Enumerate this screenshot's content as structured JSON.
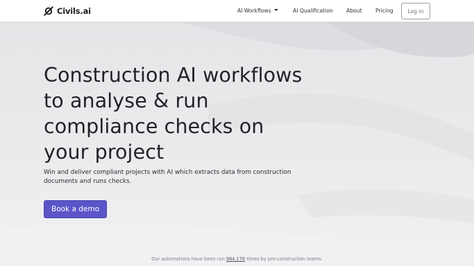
{
  "navbar": {
    "brand": "Civils.ai",
    "items": [
      {
        "label": "AI Workflows",
        "has_dropdown": true
      },
      {
        "label": "AI Qualification"
      },
      {
        "label": "About"
      },
      {
        "label": "Pricing"
      }
    ],
    "login_label": "Log in"
  },
  "hero": {
    "title": "Construction AI workflows to analyse & run compliance checks on your project",
    "subtitle": "Win and deliver compliant projects with AI which extracts data from construction documents and runs checks.",
    "cta_label": "Book a demo"
  },
  "footer_note": {
    "prefix": "Our automations have been run ",
    "count": "984,176",
    "suffix": " times by pre-construction teams."
  },
  "colors": {
    "accent": "#5b55c8",
    "background": "#ececee",
    "text": "#212226"
  },
  "icons": {
    "brand_logo": "interlinked-loops-logo",
    "dropdown": "caret-down-icon"
  }
}
